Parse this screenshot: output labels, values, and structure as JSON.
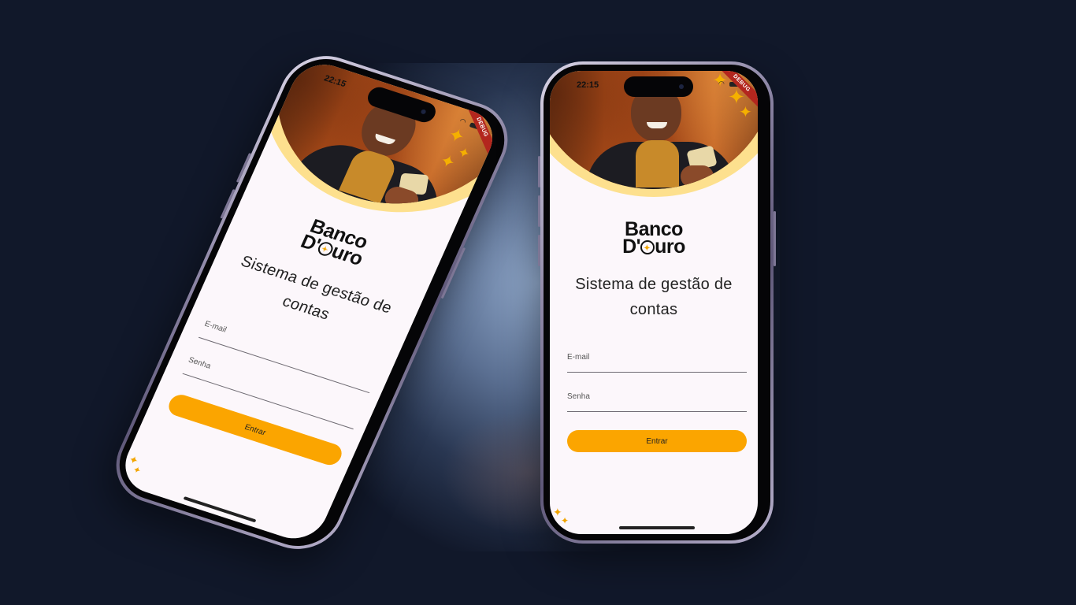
{
  "phone": {
    "time": "22:15",
    "debug_label": "DEBUG",
    "logo_line1": "Banco",
    "logo_line2_start": "D'",
    "logo_line2_end": "uro",
    "title": "Sistema de gestão de contas",
    "email_label": "E-mail",
    "password_label": "Senha",
    "submit_label": "Entrar"
  },
  "colors": {
    "background": "#11182a",
    "accent": "#fba500",
    "screen": "#fcf7fb",
    "hero_ring": "#fde08e",
    "debug_banner": "#b3261e"
  },
  "icons": [
    "wifi-icon",
    "battery-icon",
    "sparkle-icon"
  ]
}
